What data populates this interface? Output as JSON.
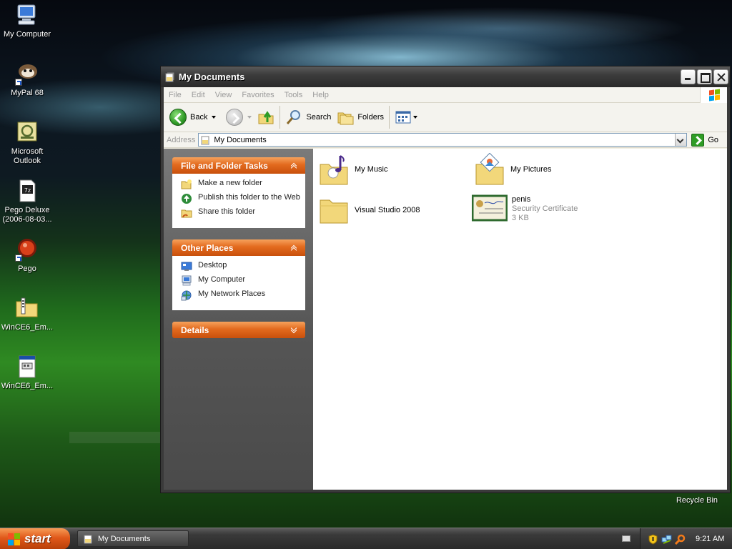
{
  "desktop": {
    "icons": [
      {
        "label": "My Computer",
        "icon": "computer-icon"
      },
      {
        "label": "MyPal 68",
        "icon": "mypal-icon"
      },
      {
        "label": "Microsoft Outlook",
        "icon": "outlook-icon"
      },
      {
        "label": "Pego Deluxe (2006-08-03...",
        "icon": "7z-archive-icon"
      },
      {
        "label": "Pego",
        "icon": "pego-icon"
      },
      {
        "label": "WinCE6_Em...",
        "icon": "zip-folder-icon"
      },
      {
        "label": "WinCE6_Em...",
        "icon": "document-icon"
      }
    ],
    "recycle_bin": "Recycle Bin"
  },
  "window": {
    "title": "My Documents",
    "menu": [
      "File",
      "Edit",
      "View",
      "Favorites",
      "Tools",
      "Help"
    ],
    "toolbar": {
      "back": "Back",
      "search": "Search",
      "folders": "Folders"
    },
    "address": {
      "label": "Address",
      "value": "My Documents",
      "go": "Go"
    },
    "task_panels": {
      "file_folder_tasks": {
        "title": "File and Folder Tasks",
        "items": [
          "Make a new folder",
          "Publish this folder to the Web",
          "Share this folder"
        ]
      },
      "other_places": {
        "title": "Other Places",
        "items": [
          "Desktop",
          "My Computer",
          "My Network Places"
        ]
      },
      "details": {
        "title": "Details"
      }
    },
    "files": [
      {
        "name": "My Music",
        "icon": "music-folder-icon"
      },
      {
        "name": "My Pictures",
        "icon": "pictures-folder-icon"
      },
      {
        "name": "Visual Studio 2008",
        "icon": "folder-icon"
      },
      {
        "name": "penis",
        "type": "Security Certificate",
        "size": "3 KB",
        "icon": "certificate-icon"
      }
    ]
  },
  "taskbar": {
    "start": "start",
    "task": "My Documents",
    "clock": "9:21 AM"
  },
  "colors": {
    "panel_header": "#e36a1e",
    "start_button": "#e0581a",
    "window_chrome": "#3c3c3c"
  }
}
